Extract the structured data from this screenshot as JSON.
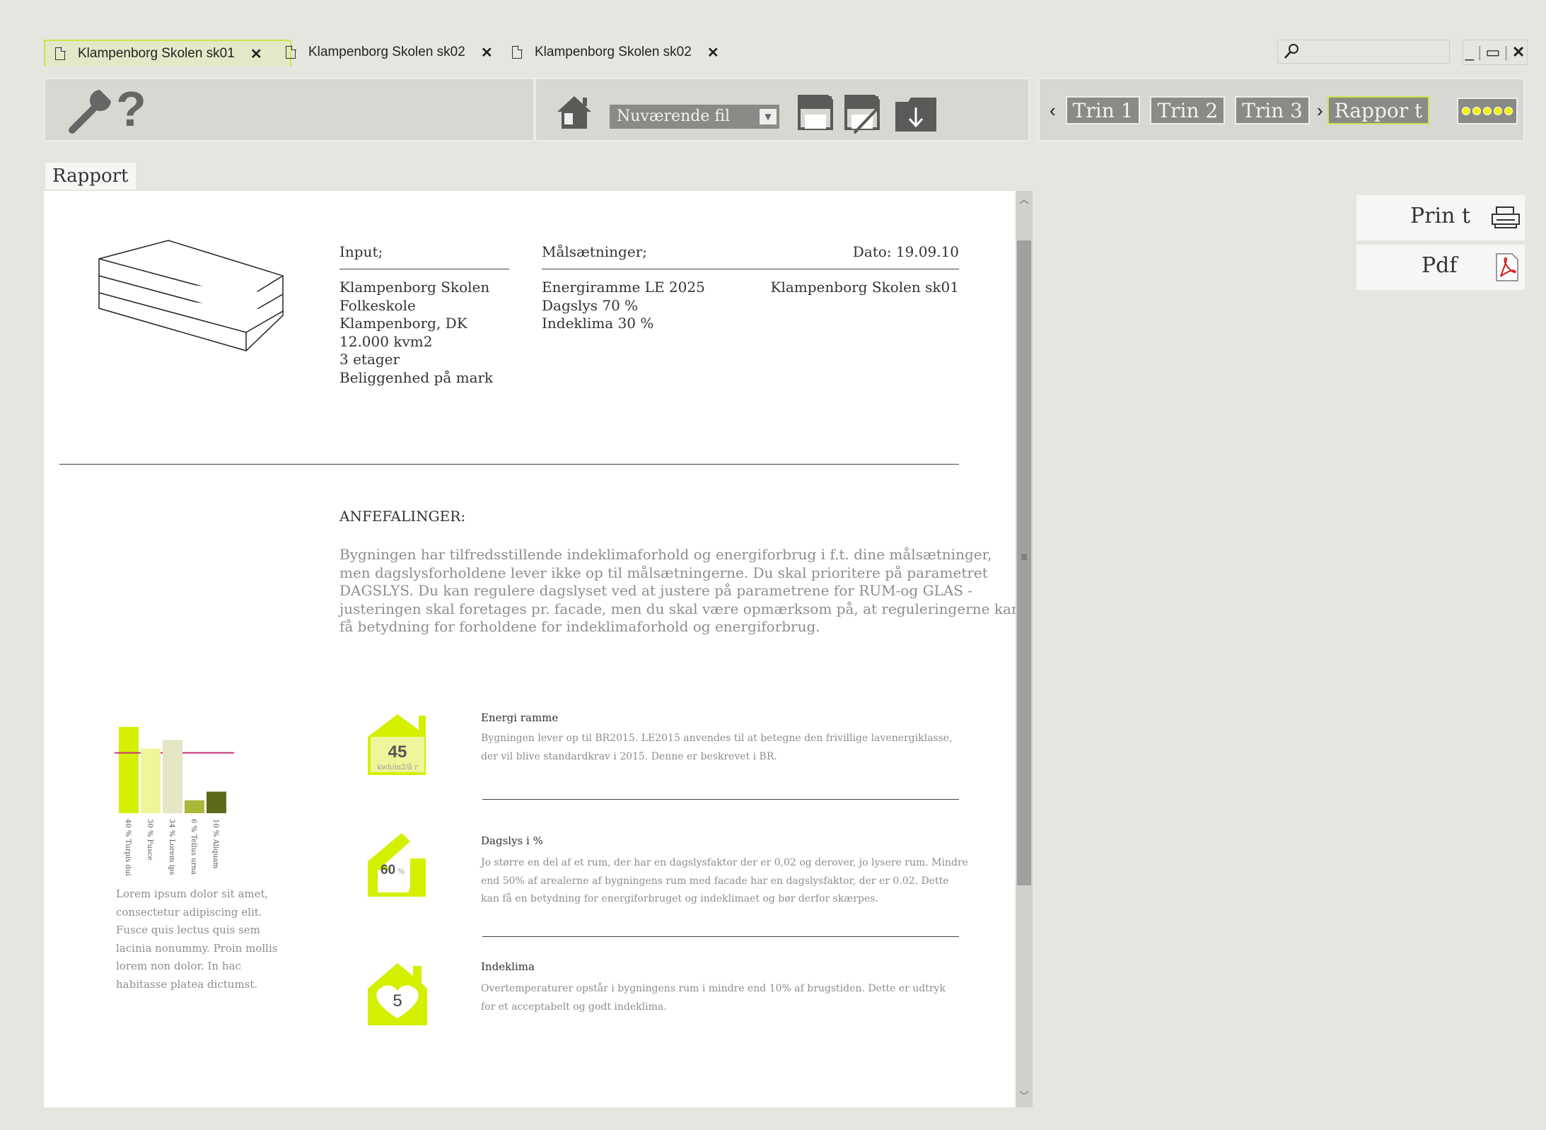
{
  "tabs": [
    {
      "label": "Klampenborg Skolen sk01",
      "active": true
    },
    {
      "label": "Klampenborg Skolen sk02",
      "active": false
    },
    {
      "label": "Klampenborg Skolen sk02",
      "active": false
    }
  ],
  "toolbar": {
    "file_select": "Nuværende fil",
    "steps": [
      "Trin 1",
      "Trin 2",
      "Trin 3"
    ],
    "report_step": "Rappor t"
  },
  "section_tab": "Rapport",
  "report": {
    "input_heading": "Input;",
    "input_lines": [
      "Klampenborg Skolen",
      "Folkeskole",
      "Klampenborg, DK",
      "12.000 kvm2",
      "3 etager",
      "Beliggenhed på mark"
    ],
    "goals_heading": "Målsætninger;",
    "goals_lines": [
      "Energiramme LE 2025",
      "Dagslys 70 %",
      "Indeklima 30 %"
    ],
    "date": "Dato: 19.09.10",
    "file_name": "Klampenborg Skolen sk01",
    "recommend_heading": "ANFEFALINGER:",
    "recommend_lines": [
      "Bygningen har tilfredsstillende indeklimaforhold og energiforbrug i f.t. dine målsætninger,",
      "men dagslysforholdene lever ikke op til målsætningerne. Du skal prioritere på parametret",
      "DAGSLYS. Du kan regulere dagslyset ved at justere på parametrene for RUM-og GLAS -",
      "justeringen skal foretages pr. facade, men du skal være opmærksom på, at reguleringerne kan",
      "få betydning for forholdene for indeklimaforhold og energiforbrug."
    ],
    "chart_caption_lines": [
      "Lorem ipsum dolor sit amet,",
      "consectetur adipiscing elit.",
      "Fusce quis lectus quis sem",
      "lacinia nonummy. Proin mollis",
      "lorem non dolor. In hac",
      "habitasse platea dictumst."
    ],
    "metrics": [
      {
        "icon": "house-energy-icon",
        "value": "45",
        "unit": "kwh/m2/å r",
        "title": "Energi ramme",
        "lines": [
          "Bygningen lever op til BR2015. LE2015 anvendes til at betegne den frivillige lavenergiklasse,",
          "der vil blive standardkrav i 2015. Denne er beskrevet i BR."
        ]
      },
      {
        "icon": "house-daylight-icon",
        "value": "60",
        "unit": "%",
        "title": "Dagslys i %",
        "lines": [
          "Jo større en del af et rum, der har en dagslysfaktor der er 0,02 og derover, jo lysere rum. Mindre",
          "end 50% af arealerne af bygningens rum med facade har en dagslysfaktor, der er 0.02. Dette",
          "kan få en betydning for energiforbruget og indeklimaet og bør derfor skærpes."
        ]
      },
      {
        "icon": "house-heart-icon",
        "value": "5",
        "unit": "",
        "title": "Indeklima",
        "lines": [
          "Overtemperaturer opstår i bygningens rum i mindre end 10% af brugstiden. Dette er udtryk",
          "for et acceptabelt og godt indeklima."
        ]
      }
    ]
  },
  "chart_data": {
    "type": "bar",
    "categories": [
      "40 % Turpis dui",
      "30 % Fusce",
      "34 % Lorem ips",
      "6 % Tellus urna",
      "10 % Aliquam"
    ],
    "values": [
      40,
      30,
      34,
      6,
      10
    ],
    "colors": [
      "#d4f000",
      "#eef59a",
      "#e4e6c4",
      "#a9b83a",
      "#5c6b1a"
    ],
    "reference_color": "#c8307a"
  },
  "side": {
    "print_label": "Prin t",
    "pdf_label": "Pdf"
  },
  "colors": {
    "accent": "#d4f000",
    "panel": "#d8d8d2",
    "background": "#e6e6e0"
  }
}
